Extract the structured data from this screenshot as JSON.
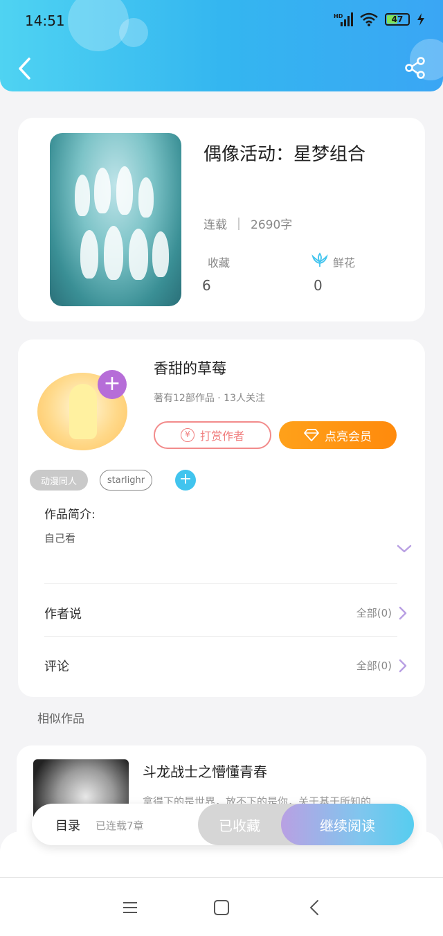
{
  "status_bar": {
    "time": "14:51",
    "battery": "47"
  },
  "book": {
    "title": "偶像活动：星梦组合",
    "status": "连载",
    "word_count": "2690字",
    "favorites_label": "收藏",
    "favorites_value": "6",
    "flowers_label": "鲜花",
    "flowers_value": "0"
  },
  "author": {
    "name": "香甜的草莓",
    "sub": "著有12部作品 · 13人关注",
    "tip_label": "打赏作者",
    "tip_icon_glyph": "¥",
    "vip_label": "点亮会员",
    "tags": [
      "动漫同人",
      "starlighr"
    ],
    "intro_label": "作品简介:",
    "intro_text": "自己看",
    "author_says_label": "作者说",
    "author_says_count": "全部(0)",
    "comments_label": "评论",
    "comments_count": "全部(0)"
  },
  "similar": {
    "section_title": "相似作品",
    "items": [
      {
        "title": "斗龙战士之懵懂青春",
        "desc": "拿得下的是世界，放不下的是你，关于基于所知的"
      }
    ]
  },
  "bottom_bar": {
    "toc_label": "目录",
    "toc_sub": "已连载7章",
    "collected_label": "已收藏",
    "continue_label": "继续阅读"
  },
  "colors": {
    "header_start": "#4fd3f2",
    "header_end": "#3aa6f4",
    "vip_orange": "#ff8a0c",
    "tip_red": "#f07d7d",
    "accent_purple": "#b66dd8",
    "accent_blue": "#41c4ee"
  }
}
